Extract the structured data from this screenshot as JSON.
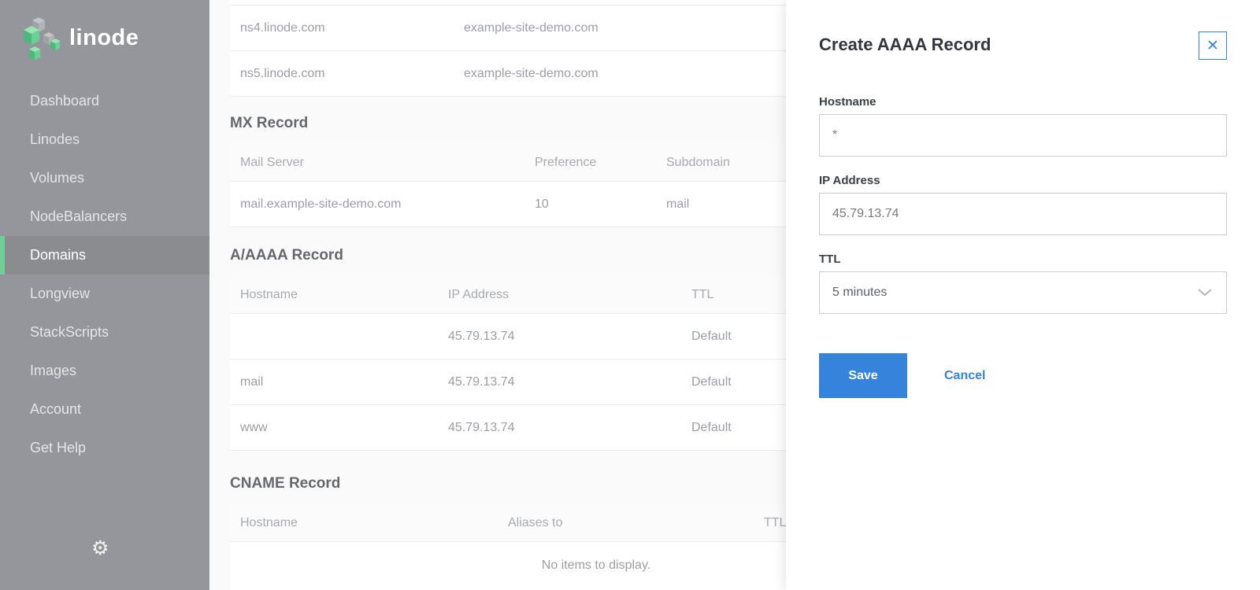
{
  "app": {
    "brand": "linode"
  },
  "colors": {
    "accent_blue": "#3683dc",
    "brand_green": "#6fcf97",
    "sidebar_gray": "#94969b"
  },
  "icons": {
    "close": "✕",
    "gear": "⚙",
    "chevron_down": "chevron-down",
    "logo": "linode-cubes"
  },
  "sidebar": {
    "items": [
      {
        "label": "Dashboard",
        "active": false
      },
      {
        "label": "Linodes",
        "active": false
      },
      {
        "label": "Volumes",
        "active": false
      },
      {
        "label": "NodeBalancers",
        "active": false
      },
      {
        "label": "Domains",
        "active": true
      },
      {
        "label": "Longview",
        "active": false
      },
      {
        "label": "StackScripts",
        "active": false
      },
      {
        "label": "Images",
        "active": false
      },
      {
        "label": "Account",
        "active": false
      },
      {
        "label": "Get Help",
        "active": false
      }
    ]
  },
  "content": {
    "ns_table": {
      "rows": [
        [
          "ns4.linode.com",
          "example-site-demo.com"
        ],
        [
          "ns5.linode.com",
          "example-site-demo.com"
        ]
      ]
    },
    "mx": {
      "title": "MX Record",
      "headers": [
        "Mail Server",
        "Preference",
        "Subdomain"
      ],
      "rows": [
        [
          "mail.example-site-demo.com",
          "10",
          "mail"
        ]
      ]
    },
    "a_aaaa": {
      "title": "A/AAAA Record",
      "headers": [
        "Hostname",
        "IP Address",
        "TTL"
      ],
      "rows": [
        [
          "",
          "45.79.13.74",
          "Default"
        ],
        [
          "mail",
          "45.79.13.74",
          "Default"
        ],
        [
          "www",
          "45.79.13.74",
          "Default"
        ]
      ]
    },
    "cname": {
      "title": "CNAME Record",
      "headers": [
        "Hostname",
        "Aliases to",
        "TTL"
      ],
      "empty_text": "No items to display."
    }
  },
  "drawer": {
    "title": "Create AAAA Record",
    "fields": {
      "hostname": {
        "label": "Hostname",
        "value": "*"
      },
      "ip": {
        "label": "IP Address",
        "value": "45.79.13.74"
      },
      "ttl": {
        "label": "TTL",
        "value": "5 minutes"
      }
    },
    "save_label": "Save",
    "cancel_label": "Cancel"
  }
}
